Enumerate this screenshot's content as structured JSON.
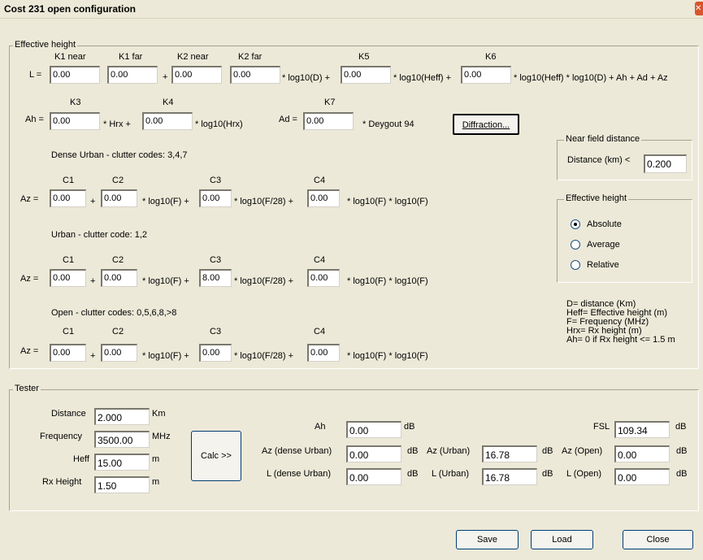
{
  "window": {
    "title": "Cost 231 open configuration",
    "close_glyph": "✕"
  },
  "effective_height_group": {
    "legend": "Effective height",
    "L_label": "L =",
    "k1_near": {
      "label": "K1 near",
      "value": "0.00"
    },
    "k1_far": {
      "label": "K1 far",
      "value": "0.00"
    },
    "k2_near": {
      "label": "K2 near",
      "value": "0.00"
    },
    "k2_far": {
      "label": "K2 far",
      "value": "0.00"
    },
    "k5": {
      "label": "K5",
      "value": "0.00"
    },
    "k6": {
      "label": "K6",
      "value": "0.00"
    },
    "plus1": "+",
    "log10d_plus": "* log10(D) +",
    "log10heff_plus": "* log10(Heff) +",
    "L_tail": "* log10(Heff) * log10(D) +  Ah + Ad + Az",
    "Ah_label": "Ah =",
    "k3": {
      "label": "K3",
      "value": "0.00"
    },
    "k4": {
      "label": "K4",
      "value": "0.00"
    },
    "hrx_plus": "* Hrx +",
    "log10hrx": "* log10(Hrx)",
    "Ad_label": "Ad =",
    "k7": {
      "label": "K7",
      "value": "0.00"
    },
    "deygout": "* Deygout 94",
    "diffraction_button": "Diffraction...",
    "c1": "C1",
    "c2": "C2",
    "c3": "C3",
    "c4": "C4",
    "Az_label": "Az =",
    "plus": "+",
    "log10f_plus": "* log10(F) +",
    "log10f28_plus": "* log10(F/28) +",
    "log10f_log10f": "* log10(F) * log10(F)",
    "dense_urban": {
      "title": "Dense Urban - clutter codes: 3,4,7",
      "c1": "0.00",
      "c2": "0.00",
      "c3": "0.00",
      "c4": "0.00"
    },
    "urban": {
      "title": "Urban - clutter code: 1,2",
      "c1": "0.00",
      "c2": "0.00",
      "c3": "8.00",
      "c4": "0.00"
    },
    "open": {
      "title": "Open - clutter codes: 0,5,6,8,>8",
      "c1": "0.00",
      "c2": "0.00",
      "c3": "0.00",
      "c4": "0.00"
    }
  },
  "near_field_group": {
    "legend": "Near field distance",
    "label": "Distance (km) <",
    "value": "0.200"
  },
  "effective_height_mode_group": {
    "legend": "Effective height",
    "options": [
      {
        "label": "Absolute",
        "selected": true
      },
      {
        "label": "Average",
        "selected": false
      },
      {
        "label": "Relative",
        "selected": false
      }
    ]
  },
  "legend_notes": [
    "D= distance (Km)",
    "Heff= Effective height (m)",
    "F= Frequency (MHz)",
    "Hrx= Rx height (m)",
    "Ah= 0 if Rx height <= 1.5 m"
  ],
  "tester_group": {
    "legend": "Tester",
    "distance": {
      "label": "Distance",
      "value": "2.000",
      "unit": "Km"
    },
    "frequency": {
      "label": "Frequency",
      "value": "3500.00",
      "unit": "MHz"
    },
    "heff": {
      "label": "Heff",
      "value": "15.00",
      "unit": "m"
    },
    "rx_height": {
      "label": "Rx Height",
      "value": "1.50",
      "unit": "m"
    },
    "calc_button": "Calc >>",
    "ah": {
      "label": "Ah",
      "value": "0.00",
      "unit": "dB"
    },
    "az_dense": {
      "label": "Az (dense Urban)",
      "value": "0.00",
      "unit": "dB"
    },
    "l_dense": {
      "label": "L (dense Urban)",
      "value": "0.00",
      "unit": "dB"
    },
    "az_urban": {
      "label": "Az (Urban)",
      "value": "16.78",
      "unit": "dB"
    },
    "l_urban": {
      "label": "L (Urban)",
      "value": "16.78",
      "unit": "dB"
    },
    "fsl": {
      "label": "FSL",
      "value": "109.34",
      "unit": "dB"
    },
    "az_open": {
      "label": "Az (Open)",
      "value": "0.00",
      "unit": "dB"
    },
    "l_open": {
      "label": "L (Open)",
      "value": "0.00",
      "unit": "dB"
    }
  },
  "footer": {
    "save": "Save",
    "load": "Load",
    "close": "Close"
  }
}
